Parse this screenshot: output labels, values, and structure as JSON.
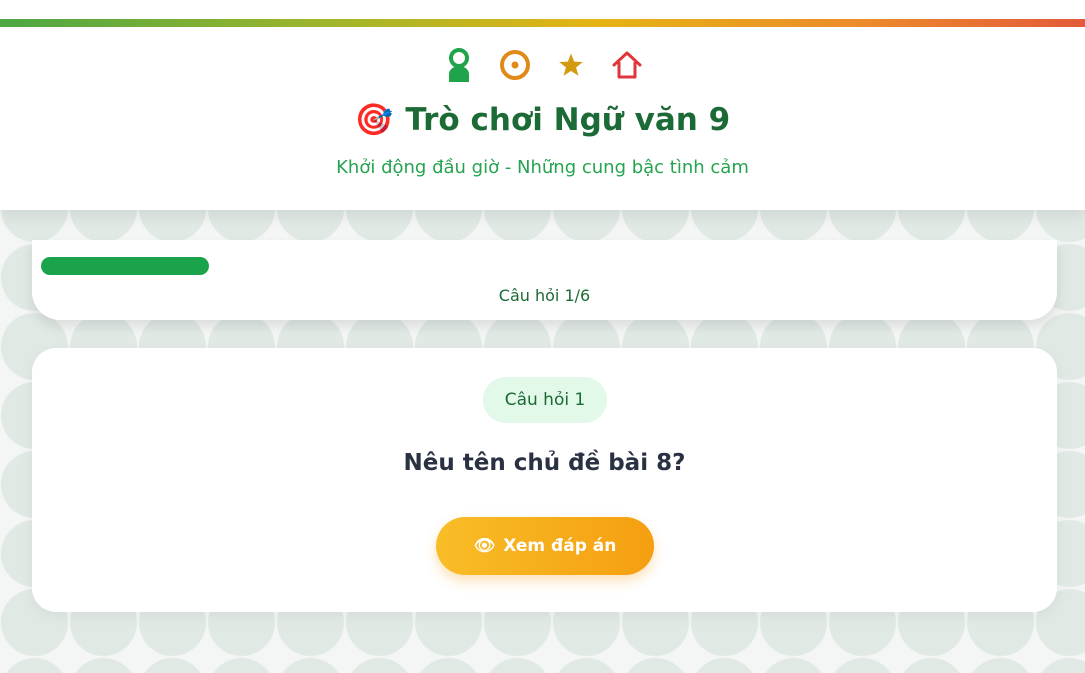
{
  "header": {
    "icons": [
      "user-icon",
      "target-ring-icon",
      "star-icon",
      "home-icon"
    ],
    "title_emoji": "🎯",
    "title": "Trò chơi Ngữ văn 9",
    "subtitle": "Khởi động đầu giờ - Những cung bậc tình cảm"
  },
  "progress": {
    "fraction": 0.1667,
    "label": "Câu hỏi 1/6"
  },
  "question": {
    "badge": "Câu hỏi 1",
    "text": "Nêu tên chủ đề bài 8?",
    "reveal_icon": "👁",
    "reveal_label": "Xem đáp án"
  },
  "colors": {
    "primary_green": "#1aa34a",
    "title_green": "#1c6a35",
    "accent_orange": "#f5a816",
    "badge_bg": "#e2f8e8"
  }
}
